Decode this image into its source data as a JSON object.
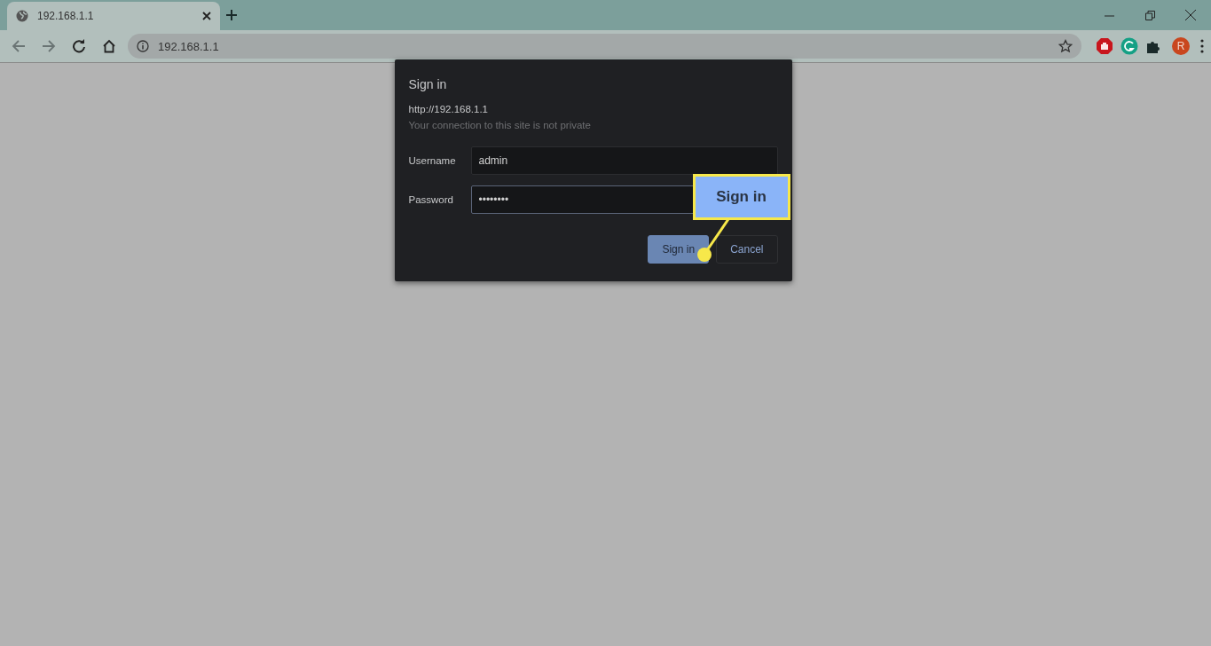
{
  "tab": {
    "title": "192.168.1.1",
    "selected": true
  },
  "address_bar": {
    "value": "192.168.1.1"
  },
  "profile": {
    "initial": "R"
  },
  "dialog": {
    "title": "Sign in",
    "url": "http://192.168.1.1",
    "note": "Your connection to this site is not private",
    "fields": [
      {
        "label": "Username",
        "value": "admin",
        "focused": false
      },
      {
        "label": "Password",
        "value": "••••••••",
        "focused": true
      }
    ],
    "buttons": [
      {
        "label": "Sign in",
        "kind": "primary"
      },
      {
        "label": "Cancel",
        "kind": "secondary"
      }
    ]
  },
  "callout": {
    "text": "Sign in"
  }
}
